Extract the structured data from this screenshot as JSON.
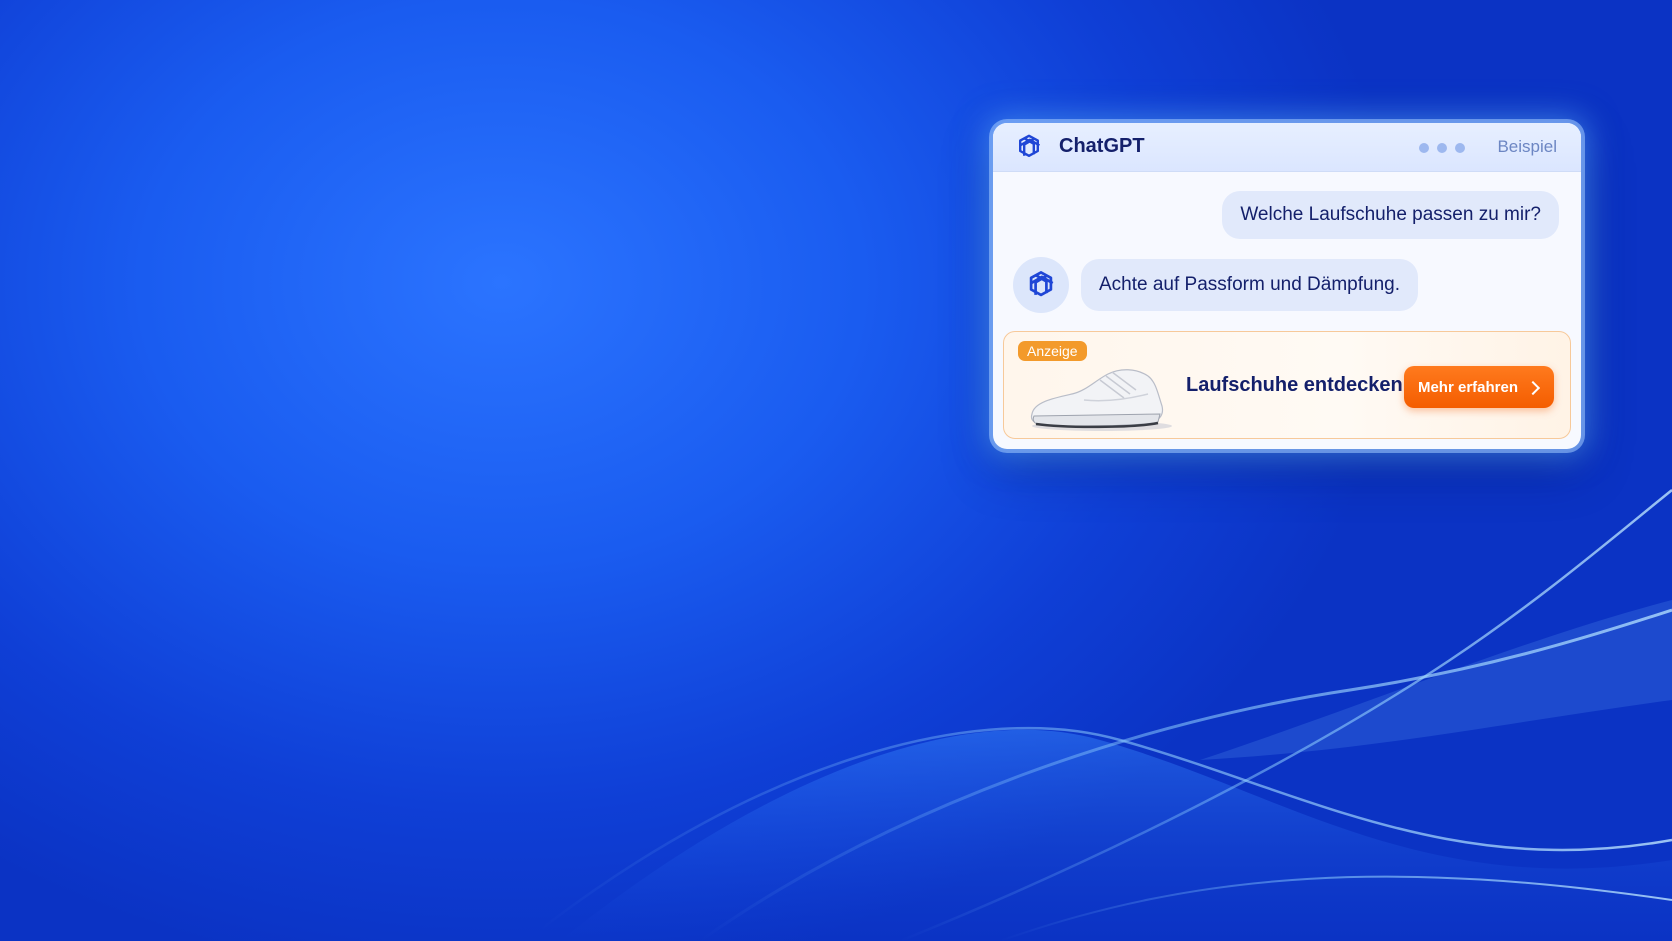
{
  "window": {
    "app_title": "ChatGPT",
    "label": "Beispiel",
    "logo_icon": "openai-logo-icon",
    "dots_icon": "more-dots-icon"
  },
  "conversation": {
    "user_message": "Welche Laufschuhe passen zu mir?",
    "assistant_message": "Achte auf Passform und Dämpfung."
  },
  "ad": {
    "badge": "Anzeige",
    "title": "Laufschuhe entdecken",
    "cta_label": "Mehr erfahren",
    "product_icon": "running-shoe-image"
  },
  "colors": {
    "accent_orange": "#f45d00",
    "text_navy": "#14206b",
    "background_blue": "#1a5cf0"
  }
}
